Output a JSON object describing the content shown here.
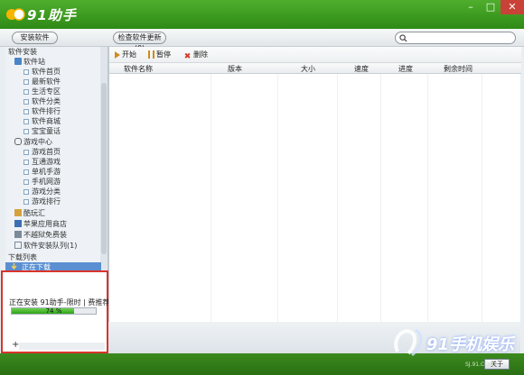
{
  "app": {
    "title": "91助手"
  },
  "toolbar": {
    "install_label": "安装软件",
    "update_label": "检查软件更新(0)",
    "search_placeholder": ""
  },
  "sidebar": {
    "section_software": "软件安装",
    "software_store": "软件站",
    "software_items": [
      "软件首页",
      "最新软件",
      "生活专区",
      "软件分类",
      "软件排行",
      "软件商城",
      "宝宝童话"
    ],
    "game_center": "游戏中心",
    "game_items": [
      "游戏首页",
      "互通游戏",
      "单机手游",
      "手机网游",
      "游戏分类",
      "游戏排行"
    ],
    "extra_items": [
      "酷玩汇",
      "苹果应用商店",
      "不越狱免费装",
      "软件安装队列(1)"
    ],
    "download_section": "下载列表",
    "selected": "正在下载"
  },
  "download": {
    "status_text": "正在安装 91助手-限时 | 费推荐: 通",
    "progress_text": "74 %",
    "progress": 0.74,
    "plus": "+"
  },
  "main": {
    "actions": [
      "开始",
      "暂停",
      "删除"
    ],
    "columns": [
      "软件名称",
      "版本",
      "大小",
      "速度",
      "进度",
      "剩余时间"
    ]
  },
  "footer": {
    "about_label": "关于",
    "watermark": "91手机娱乐",
    "site": "SJ.91.COM"
  },
  "colors": {
    "title_green": "#3c9a22",
    "accent_red": "#d9342c",
    "selection_blue": "#5b8fd1"
  }
}
